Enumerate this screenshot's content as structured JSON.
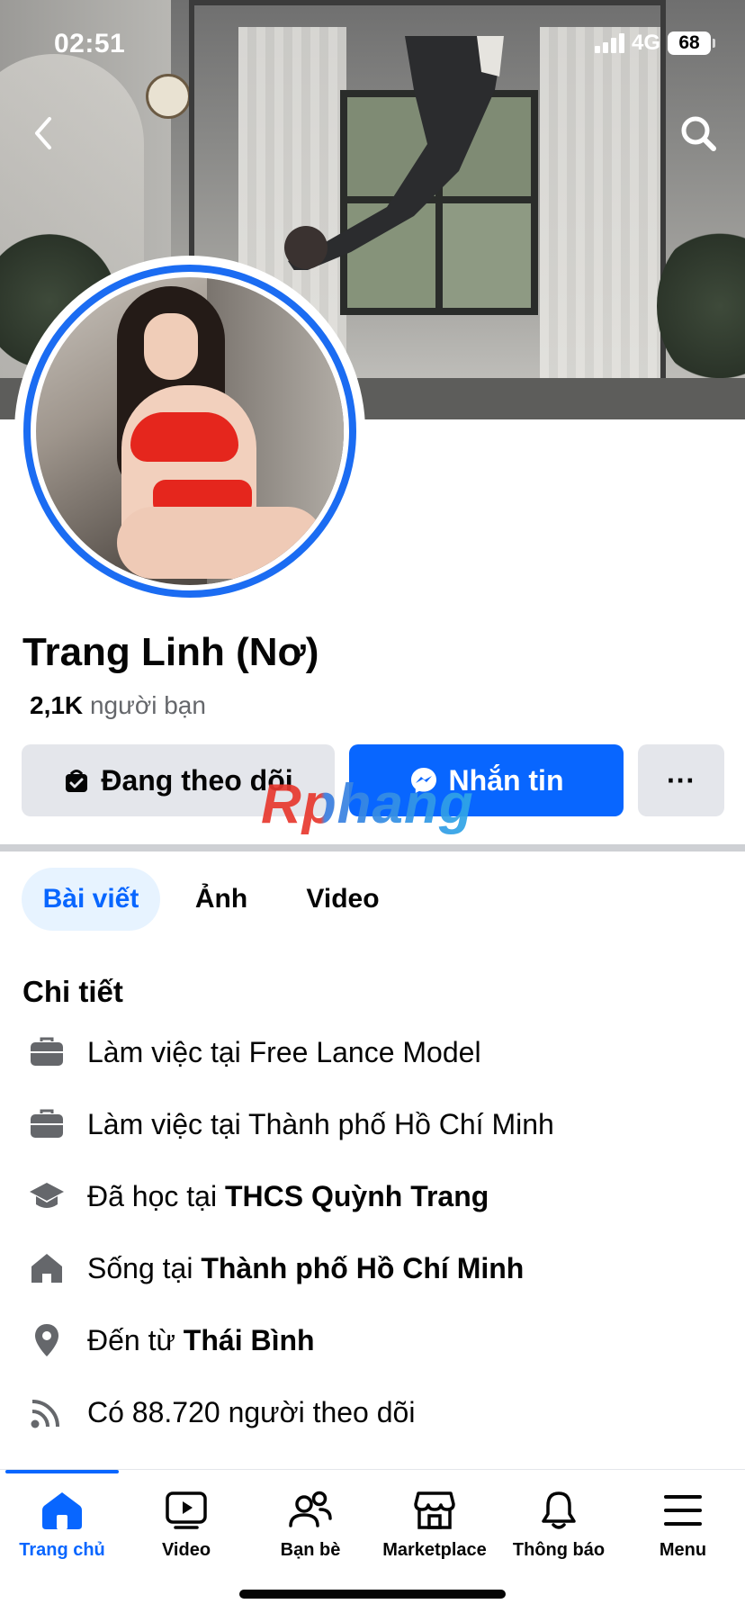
{
  "status_bar": {
    "time": "02:51",
    "network": "4G",
    "battery": "68"
  },
  "profile": {
    "name": "Trang Linh (Nơ)",
    "friends_count": "2,1K",
    "friends_label": "người bạn"
  },
  "actions": {
    "follow_label": "Đang theo dõi",
    "message_label": "Nhắn tin",
    "more_label": "···"
  },
  "watermark": "Rphang",
  "tabs": [
    {
      "label": "Bài viết",
      "active": true
    },
    {
      "label": "Ảnh",
      "active": false
    },
    {
      "label": "Video",
      "active": false
    }
  ],
  "details": {
    "title": "Chi tiết",
    "items": [
      {
        "icon": "briefcase-icon",
        "prefix": "Làm việc tại Free Lance Model",
        "bold": ""
      },
      {
        "icon": "briefcase-icon",
        "prefix": "Làm việc tại Thành phố Hồ Chí Minh",
        "bold": ""
      },
      {
        "icon": "graduation-cap-icon",
        "prefix": "Đã học tại ",
        "bold": "THCS Quỳnh Trang"
      },
      {
        "icon": "home-icon",
        "prefix": "Sống tại ",
        "bold": "Thành phố Hồ Chí Minh"
      },
      {
        "icon": "location-pin-icon",
        "prefix": "Đến từ ",
        "bold": "Thái Bình"
      },
      {
        "icon": "rss-feed-icon",
        "prefix": "Có 88.720 người theo dõi",
        "bold": ""
      }
    ]
  },
  "bottom_nav": [
    {
      "label": "Trang chủ",
      "icon": "home-icon",
      "active": true
    },
    {
      "label": "Video",
      "icon": "video-play-icon",
      "active": false
    },
    {
      "label": "Bạn bè",
      "icon": "friends-icon",
      "active": false
    },
    {
      "label": "Marketplace",
      "icon": "marketplace-icon",
      "active": false
    },
    {
      "label": "Thông báo",
      "icon": "bell-icon",
      "active": false
    },
    {
      "label": "Menu",
      "icon": "hamburger-menu-icon",
      "active": false
    }
  ],
  "colors": {
    "accent": "#0866ff",
    "avatar_ring": "#1b6cf2",
    "button_gray": "#e4e6eb",
    "secondary_text": "#65676b",
    "tab_active_bg": "#e7f3ff"
  }
}
